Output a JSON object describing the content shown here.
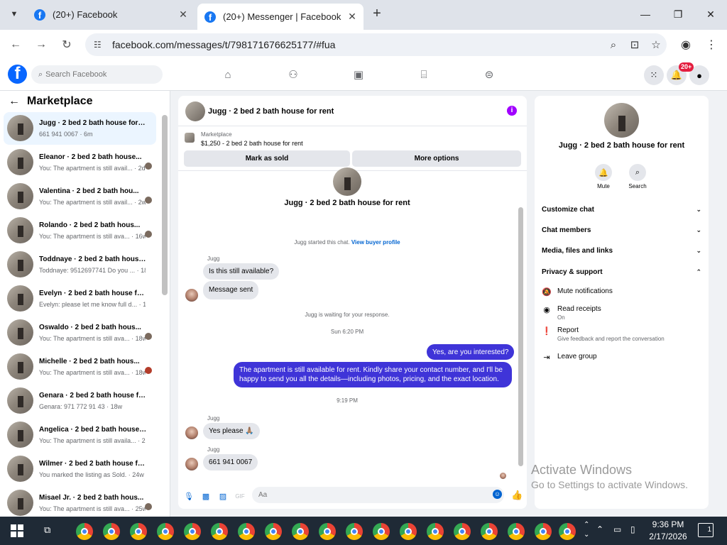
{
  "browser": {
    "tabs": [
      {
        "title": "(20+) Facebook",
        "favicon": "f"
      },
      {
        "title": "(20+) Messenger | Facebook",
        "favicon": "f"
      }
    ],
    "url": "facebook.com/messages/t/798171676625177/#fua"
  },
  "fb": {
    "search_placeholder": "Search Facebook",
    "notifications_badge": "20+"
  },
  "left": {
    "header": "Marketplace",
    "conversations": [
      {
        "name": "Jugg · 2 bed 2 bath house for r...",
        "snippet": "661 941 0067 · 6m",
        "active": true
      },
      {
        "name": "Eleanor · 2 bed 2 bath house...",
        "snippet": "You: The apartment is still avail... · 2d"
      },
      {
        "name": "Valentina · 2 bed 2 bath hou...",
        "snippet": "You: The apartment is still avail... · 2w"
      },
      {
        "name": "Rolando · 2 bed 2 bath hous...",
        "snippet": "You: The apartment is still ava... · 16w"
      },
      {
        "name": "Toddnaye · 2 bed 2 bath house ...",
        "snippet": "Toddnaye: 9512697741 Do you ... · 18w"
      },
      {
        "name": "Evelyn · 2 bed 2 bath house for...",
        "snippet": "Evelyn: please let me know full d... · 18w"
      },
      {
        "name": "Oswaldo · 2 bed 2 bath hous...",
        "snippet": "You: The apartment is still ava... · 18w"
      },
      {
        "name": "Michelle · 2 bed 2 bath hous...",
        "snippet": "You: The apartment is still ava... · 18w"
      },
      {
        "name": "Genara · 2 bed 2 bath house fo...",
        "snippet": "Genara: 971 772 91 43 · 18w"
      },
      {
        "name": "Angelica · 2 bed 2 bath house f...",
        "snippet": "You: The apartment is still availa... · 23w"
      },
      {
        "name": "Wilmer · 2 bed 2 bath house fo...",
        "snippet": "You marked the listing as Sold. · 24w"
      },
      {
        "name": "Misael Jr. · 2 bed 2 bath hous...",
        "snippet": "You: The apartment is still ava... · 25w"
      }
    ]
  },
  "chat": {
    "title": "Jugg · 2 bed 2 bath house for rent",
    "listing_tag": "Marketplace",
    "listing_price": "$1,250 - 2 bed 2 bath house for rent",
    "btn_mark_sold": "Mark as sold",
    "btn_more": "More options",
    "started_text": "Jugg started this chat.",
    "view_profile": "View buyer profile",
    "sender1": "Jugg",
    "msg1": "Is this still available?",
    "msg2": "Message sent",
    "waiting": "Jugg is waiting for your response.",
    "time1": "Sun 6:20 PM",
    "out1": "Yes, are you interested?",
    "out2": "The apartment is still available for rent. Kindly share your contact number, and I'll be happy to send you all the details—including photos, pricing, and the exact location.",
    "time2": "9:19 PM",
    "sender2": "Jugg",
    "msg3": "Yes please 🙏🏽",
    "sender3": "Jugg",
    "msg4": "661 941 0067",
    "composer_placeholder": "Aa"
  },
  "right": {
    "name": "Jugg · 2 bed 2 bath house for rent",
    "mute": "Mute",
    "search": "Search",
    "rows": [
      "Customize chat",
      "Chat members",
      "Media, files and links",
      "Privacy & support"
    ],
    "mute_notifications": "Mute notifications",
    "read_receipts": "Read receipts",
    "read_receipts_state": "On",
    "report": "Report",
    "report_desc": "Give feedback and report the conversation",
    "leave_group": "Leave group"
  },
  "watermark": {
    "line1": "Activate Windows",
    "line2": "Go to Settings to activate Windows."
  },
  "taskbar": {
    "time": "9:36 PM",
    "date": "2/17/2026",
    "notif_count": "1"
  },
  "colors": {
    "accent": "#0866ff",
    "outgoing_bubble": "#3f34d8",
    "info_icon": "#a100ff",
    "badge": "#e41e3f"
  }
}
